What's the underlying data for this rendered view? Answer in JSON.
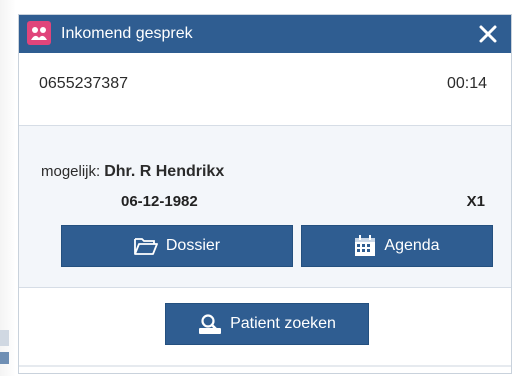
{
  "dialog": {
    "title": "Inkomend gesprek",
    "app_icon": "app-logo-icon",
    "close_icon": "close-icon"
  },
  "call": {
    "phone_number": "0655237387",
    "duration": "00:14"
  },
  "match": {
    "prefix": "mogelijk:",
    "name": "Dhr. R Hendrikx",
    "birth_date": "06-12-1982",
    "code": "X1"
  },
  "actions": {
    "dossier_label": "Dossier",
    "dossier_icon": "folder-open-icon",
    "agenda_label": "Agenda",
    "agenda_icon": "calendar-icon",
    "search_label": "Patient zoeken",
    "search_icon": "search-icon"
  },
  "colors": {
    "titlebar": "#2f5d91",
    "button": "#2f5d91",
    "app_icon": "#e0457b",
    "dialog_bg": "#f3f6fa"
  }
}
